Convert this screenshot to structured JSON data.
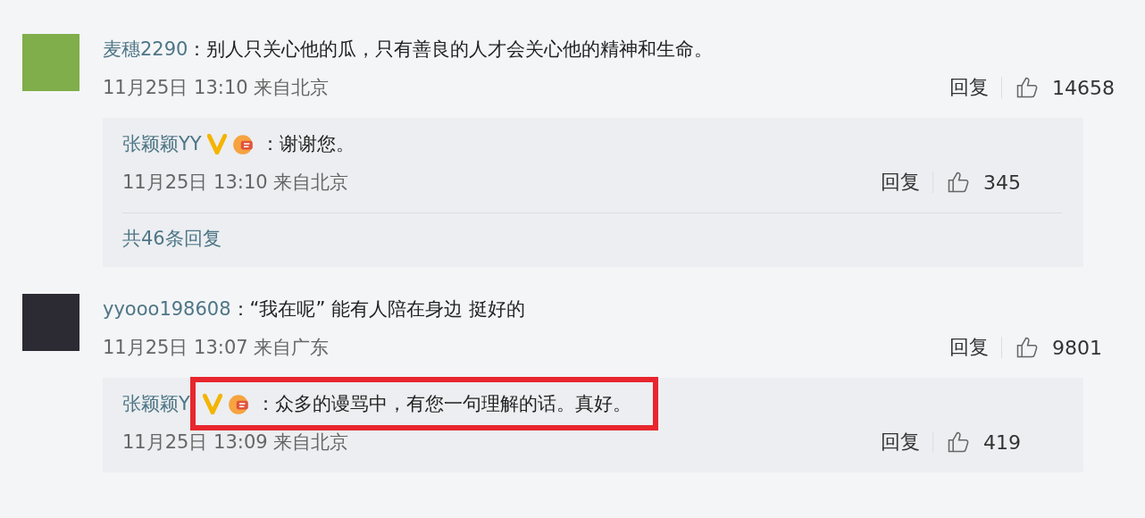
{
  "comments": [
    {
      "user": "麦穗2290",
      "text": "：别人只关心他的瓜，只有善良的人才会关心他的精神和生命。",
      "date": "11月25日 13:10",
      "location": "来自北京",
      "reply_label": "回复",
      "likes": "14658",
      "replies": [
        {
          "user": "张颖颖YY",
          "verified": true,
          "fan_badge": true,
          "highlighted": false,
          "text": "：谢谢您。",
          "date": "11月25日 13:10",
          "location": "来自北京",
          "reply_label": "回复",
          "likes": "345"
        }
      ],
      "more_replies": "共46条回复"
    },
    {
      "user": "yyooo198608",
      "text": "：“我在呢” 能有人陪在身边 挺好的",
      "date": "11月25日 13:07",
      "location": "来自广东",
      "reply_label": "回复",
      "likes": "9801",
      "replies": [
        {
          "user": "张颖颖Y",
          "verified": true,
          "fan_badge": true,
          "highlighted": true,
          "text": "：众多的谩骂中，有您一句理解的话。真好。",
          "date": "11月25日 13:09",
          "location": "来自北京",
          "reply_label": "回复",
          "likes": "419"
        }
      ]
    }
  ]
}
